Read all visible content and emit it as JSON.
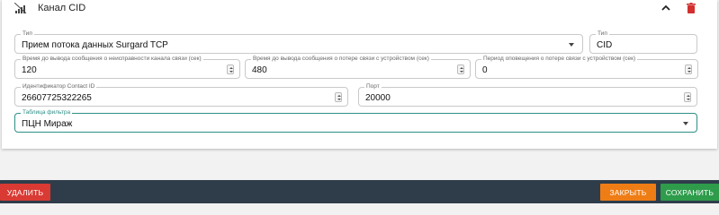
{
  "panel": {
    "title": "Канал CID",
    "icons": {
      "channel": "signal-icon",
      "collapse": "chevron-up-icon",
      "delete": "trash-icon"
    }
  },
  "fields": {
    "receiver_type": {
      "label": "Тип",
      "value": "Прием потока данных Surgard TCP"
    },
    "type": {
      "label": "Тип",
      "value": "CID"
    },
    "fault_delay": {
      "label": "Время до вывода сообщения о неисправности канала связи (сек)",
      "value": "120"
    },
    "lost_delay": {
      "label": "Время до вывода сообщения о потере связи с устройством (сек)",
      "value": "480"
    },
    "notify_period": {
      "label": "Период оповещения о потере связи с устройством (сек)",
      "value": "0"
    },
    "contact_id": {
      "label": "Идентификатор Contact ID",
      "value": "26607725322265"
    },
    "port": {
      "label": "Порт",
      "value": "20000"
    },
    "filter_table": {
      "label": "Таблица фильтра",
      "value": "ПЦН Мираж"
    }
  },
  "footer": {
    "delete_label": "УДАЛИТЬ",
    "close_label": "ЗАКРЫТЬ",
    "save_label": "СОХРАНИТЬ"
  },
  "colors": {
    "accent": "#2e8f86",
    "delete": "#d93a33",
    "close": "#ef7d15",
    "save": "#2e9c4b",
    "footer_bg": "#2f3d4b",
    "trash": "#d32f2f"
  }
}
